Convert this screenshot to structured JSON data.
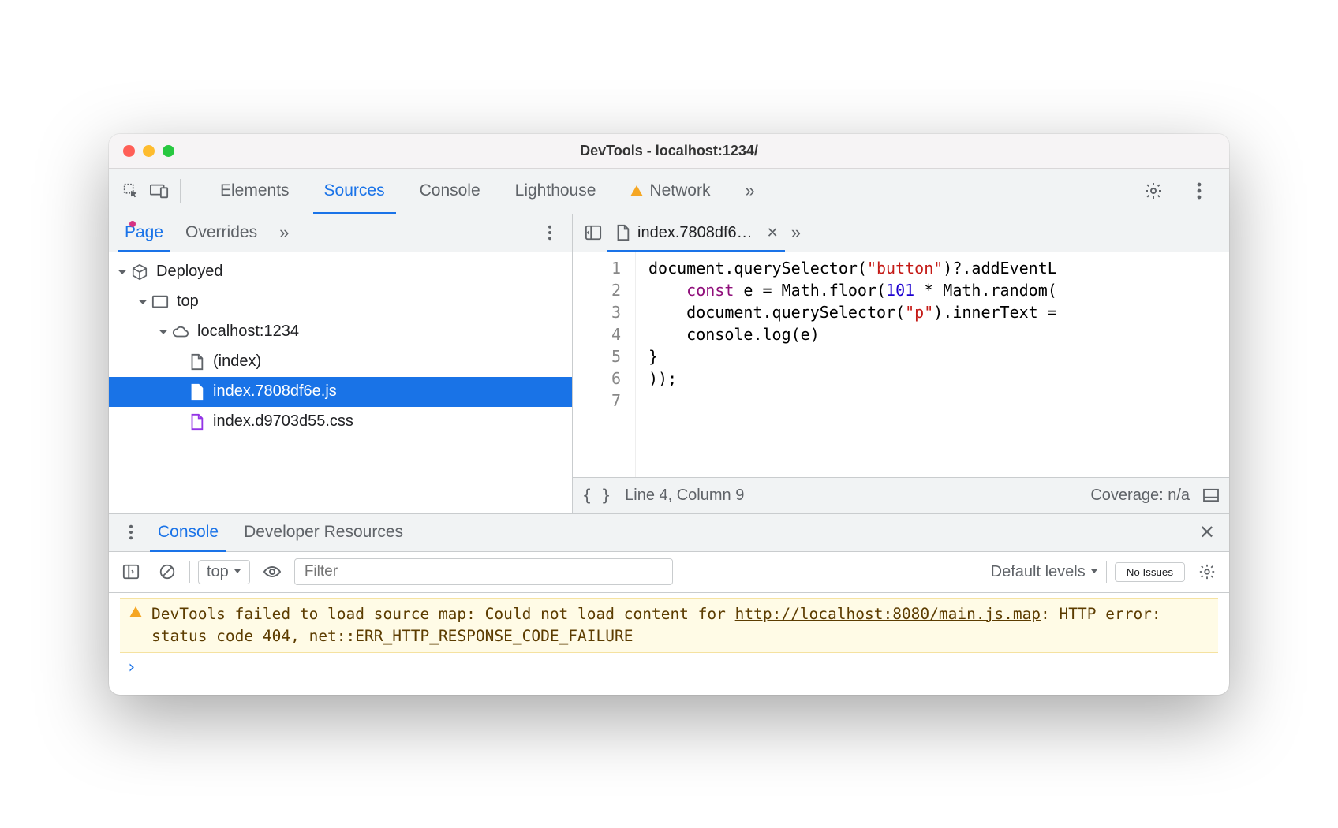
{
  "window_title": "DevTools - localhost:1234/",
  "tabs": {
    "elements": "Elements",
    "sources": "Sources",
    "console": "Console",
    "lighthouse": "Lighthouse",
    "network": "Network"
  },
  "sources_panel": {
    "nav_tabs": {
      "page": "Page",
      "overrides": "Overrides"
    },
    "tree": {
      "deployed": "Deployed",
      "top": "top",
      "origin": "localhost:1234",
      "index_html": "(index)",
      "index_js": "index.7808df6e.js",
      "index_css": "index.d9703d55.css"
    },
    "open_file_tab": "index.7808df6…",
    "code_lines": [
      "document.querySelector(\"button\")?.addEventL",
      "    const e = Math.floor(101 * Math.random(",
      "    document.querySelector(\"p\").innerText =",
      "    console.log(e)",
      "}",
      "));",
      ""
    ],
    "status": {
      "cursor": "Line 4, Column 9",
      "coverage": "Coverage: n/a"
    }
  },
  "drawer": {
    "tabs": {
      "console": "Console",
      "devres": "Developer Resources"
    }
  },
  "console_panel": {
    "context": "top",
    "filter_placeholder": "Filter",
    "levels": "Default levels",
    "issues": "No Issues",
    "warning_prefix": "DevTools failed to load source map: Could not load content for ",
    "warning_url": "http://localhost:8080/main.js.map",
    "warning_suffix": ": HTTP error: status code 404, net::ERR_HTTP_RESPONSE_CODE_FAILURE"
  }
}
